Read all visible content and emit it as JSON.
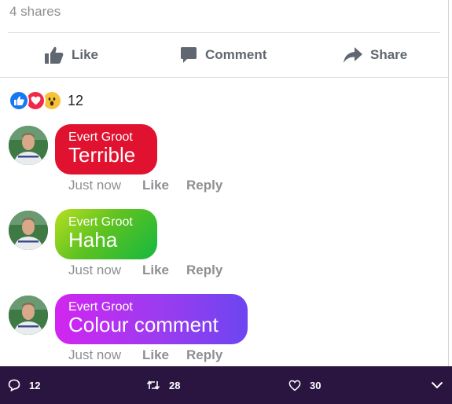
{
  "post": {
    "shares": "4 shares",
    "actions": {
      "like": "Like",
      "comment": "Comment",
      "share": "Share"
    },
    "reactions": {
      "icons": [
        "like-icon",
        "love-icon",
        "wow-icon"
      ],
      "count": "12"
    }
  },
  "comments": [
    {
      "author": "Evert Groot",
      "text": "Terrible",
      "time": "Just now",
      "like": "Like",
      "reply": "Reply",
      "color": "#e0122f"
    },
    {
      "author": "Evert Groot",
      "text": "Haha",
      "time": "Just now",
      "like": "Like",
      "reply": "Reply",
      "color": "#5fc221"
    },
    {
      "author": "Evert Groot",
      "text": "Colour comment",
      "time": "Just now",
      "like": "Like",
      "reply": "Reply",
      "color": "#9b3cf0"
    }
  ],
  "tweet_bar": {
    "replies": "12",
    "retweets": "28",
    "likes": "30"
  },
  "colors": {
    "bar_background": "#2a1440",
    "facebook_blue": "#1877f2",
    "muted_text": "#8e8f92"
  }
}
